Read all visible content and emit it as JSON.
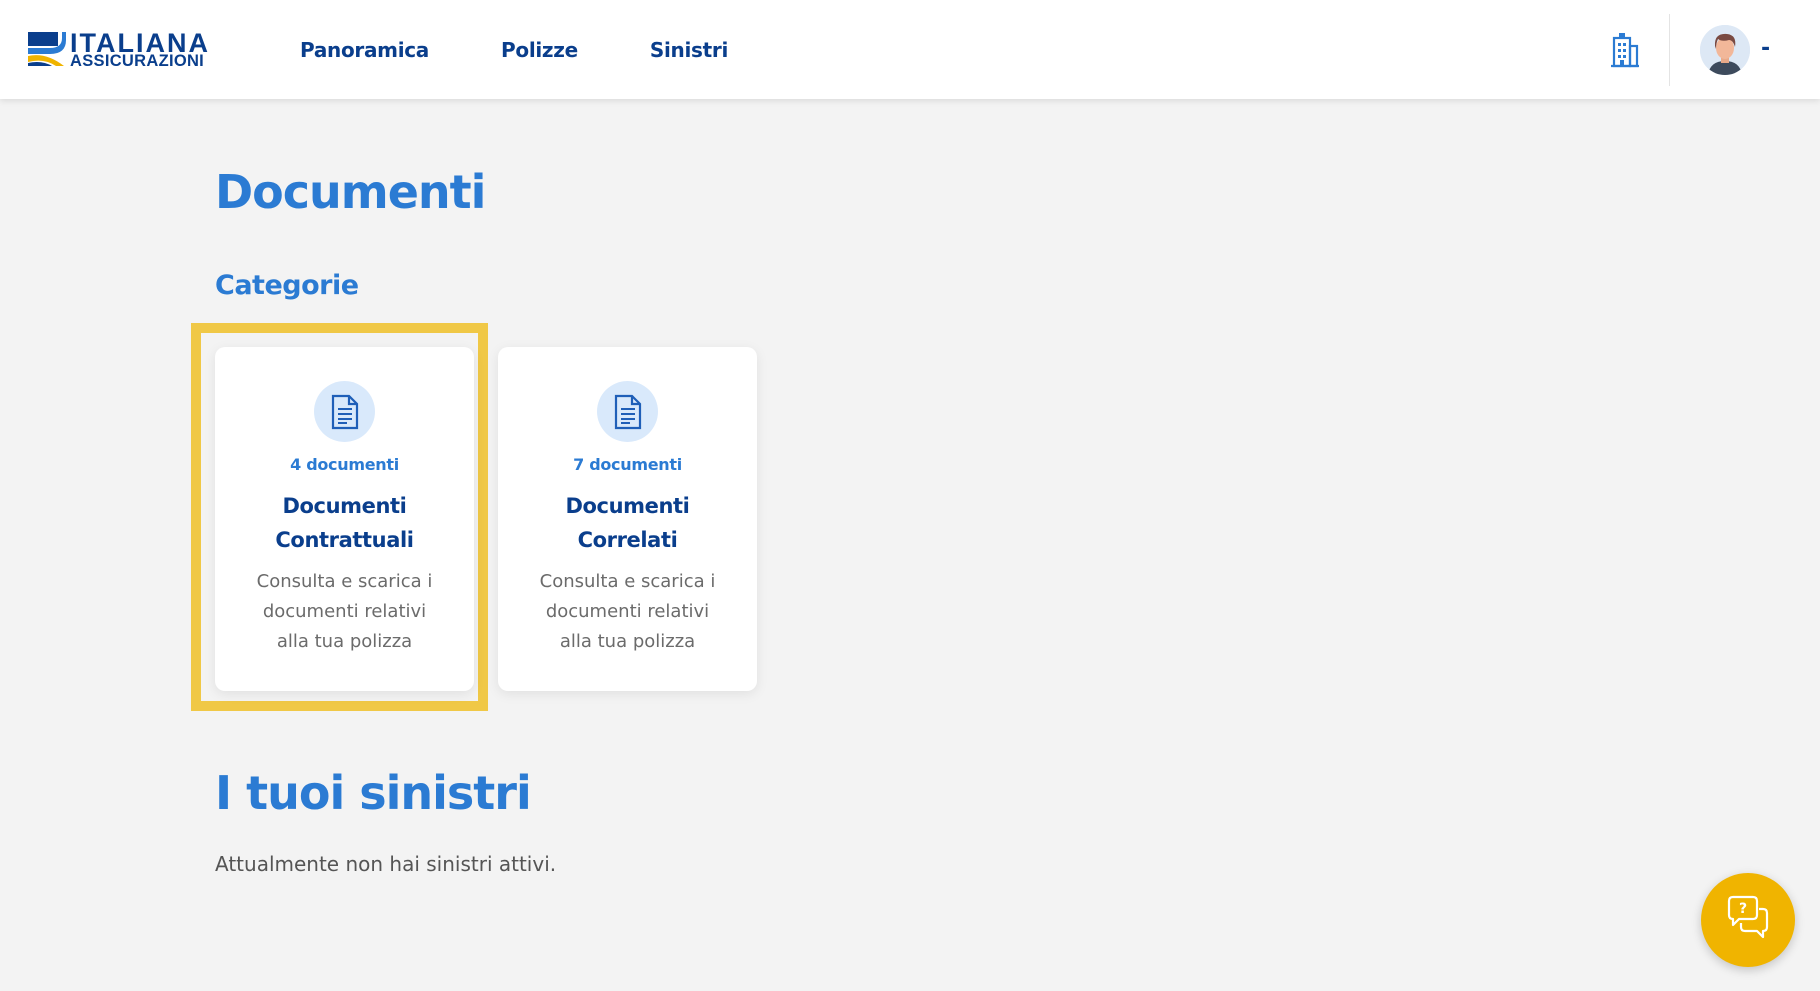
{
  "header": {
    "logo": {
      "line1": "ITALIANA",
      "line2": "ASSICURAZIONI"
    },
    "nav": [
      {
        "label": "Panoramica"
      },
      {
        "label": "Polizze"
      },
      {
        "label": "Sinistri"
      }
    ],
    "company_icon": "building-icon",
    "user_name": "-"
  },
  "main": {
    "page_title": "Documenti",
    "categories_title": "Categorie",
    "cards": [
      {
        "count": "4 documenti",
        "title": "Documenti Contrattuali",
        "description": "Consulta e scarica i documenti relativi alla tua polizza",
        "icon": "document-icon",
        "highlighted": true
      },
      {
        "count": "7 documenti",
        "title": "Documenti Correlati",
        "description": "Consulta e scarica i documenti relativi alla tua polizza",
        "icon": "document-icon",
        "highlighted": false
      }
    ],
    "claims_title": "I tuoi sinistri",
    "claims_empty": "Attualmente non hai sinistri attivi."
  },
  "help_button": {
    "icon": "chat-help-icon"
  },
  "colors": {
    "brand_dark": "#0a3e8c",
    "accent_blue": "#2b7bd3",
    "highlight": "#f0c846",
    "help_button": "#f0b400",
    "background": "#f3f3f3"
  }
}
